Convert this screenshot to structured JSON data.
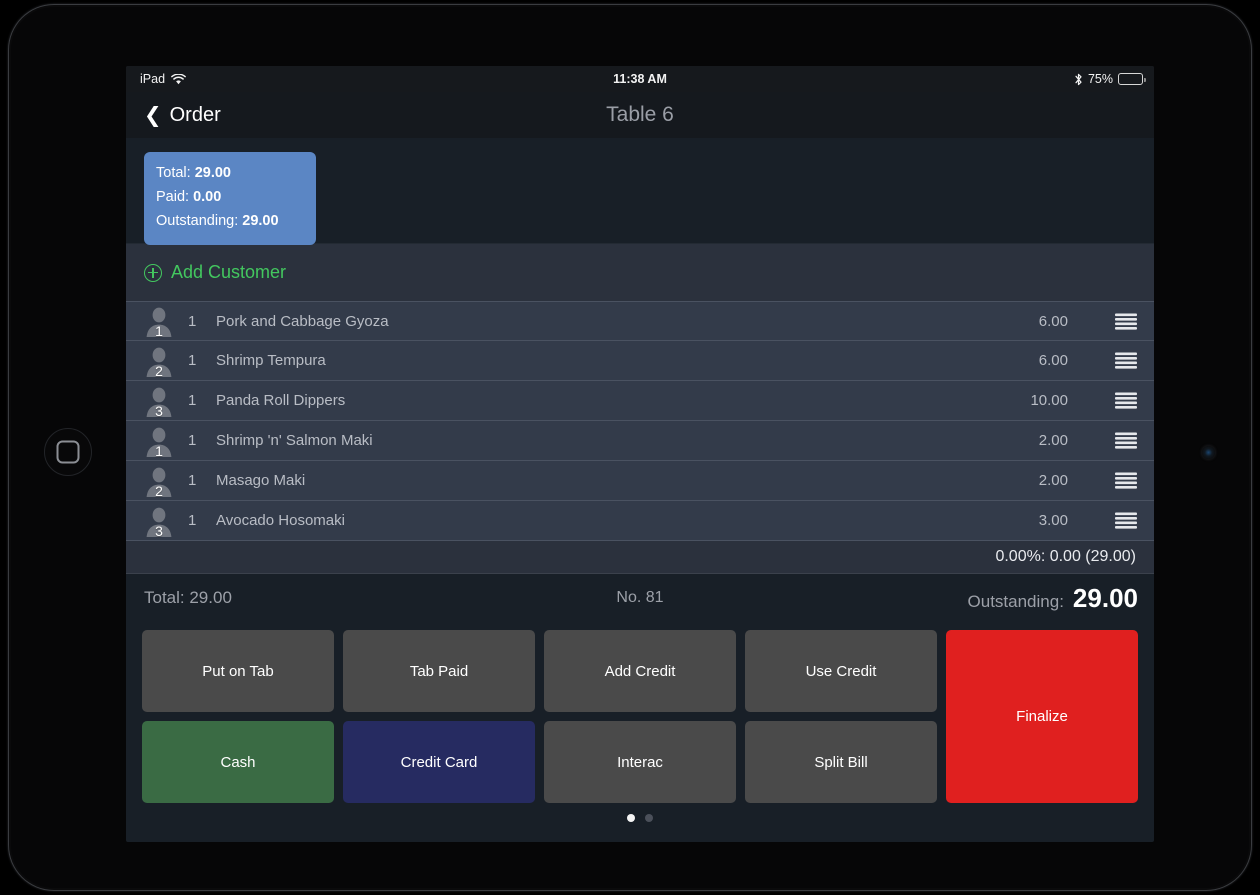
{
  "status_bar": {
    "carrier": "iPad",
    "wifi_icon": "wifi-icon",
    "time": "11:38 AM",
    "bluetooth_icon": "bluetooth-icon",
    "battery_percent": "75%",
    "battery_level": 75
  },
  "nav": {
    "back_chevron": "chevron-left-icon",
    "back_label": "Order",
    "title": "Table 6"
  },
  "summary": {
    "total_label": "Total:",
    "total_value": "29.00",
    "paid_label": "Paid:",
    "paid_value": "0.00",
    "outstanding_label": "Outstanding:",
    "outstanding_value": "29.00",
    "card_color": "#5b86c4"
  },
  "add_customer": {
    "icon": "plus-circle-icon",
    "label": "Add Customer",
    "color": "#43c75f"
  },
  "order_items": [
    {
      "seat": "1",
      "qty": "1",
      "name": "Pork and Cabbage Gyoza",
      "price": "6.00",
      "handle_icon": "reorder-handle-icon"
    },
    {
      "seat": "2",
      "qty": "1",
      "name": "Shrimp Tempura",
      "price": "6.00",
      "handle_icon": "reorder-handle-icon"
    },
    {
      "seat": "3",
      "qty": "1",
      "name": "Panda Roll Dippers",
      "price": "10.00",
      "handle_icon": "reorder-handle-icon"
    },
    {
      "seat": "1",
      "qty": "1",
      "name": "Shrimp 'n' Salmon Maki",
      "price": "2.00",
      "handle_icon": "reorder-handle-icon"
    },
    {
      "seat": "2",
      "qty": "1",
      "name": "Masago Maki",
      "price": "2.00",
      "handle_icon": "reorder-handle-icon"
    },
    {
      "seat": "3",
      "qty": "1",
      "name": "Avocado Hosomaki",
      "price": "3.00",
      "handle_icon": "reorder-handle-icon"
    }
  ],
  "tax_line": "0.00%: 0.00 (29.00)",
  "totals": {
    "total": "Total:  29.00",
    "order_number": "No. 81",
    "outstanding_label": "Outstanding:",
    "outstanding_value": "29.00"
  },
  "payment_buttons": [
    {
      "label": "Put on Tab",
      "style": "grey"
    },
    {
      "label": "Tab Paid",
      "style": "grey"
    },
    {
      "label": "Add Credit",
      "style": "grey"
    },
    {
      "label": "Use Credit",
      "style": "grey"
    },
    {
      "label": "Finalize",
      "style": "red"
    },
    {
      "label": "Cash",
      "style": "green"
    },
    {
      "label": "Credit Card",
      "style": "navy"
    },
    {
      "label": "Interac",
      "style": "grey"
    },
    {
      "label": "Split Bill",
      "style": "grey"
    }
  ],
  "pagination": {
    "pages": 2,
    "active": 1
  },
  "device": {
    "home_button_icon": "home-button-icon",
    "camera_icon": "front-camera-icon"
  }
}
